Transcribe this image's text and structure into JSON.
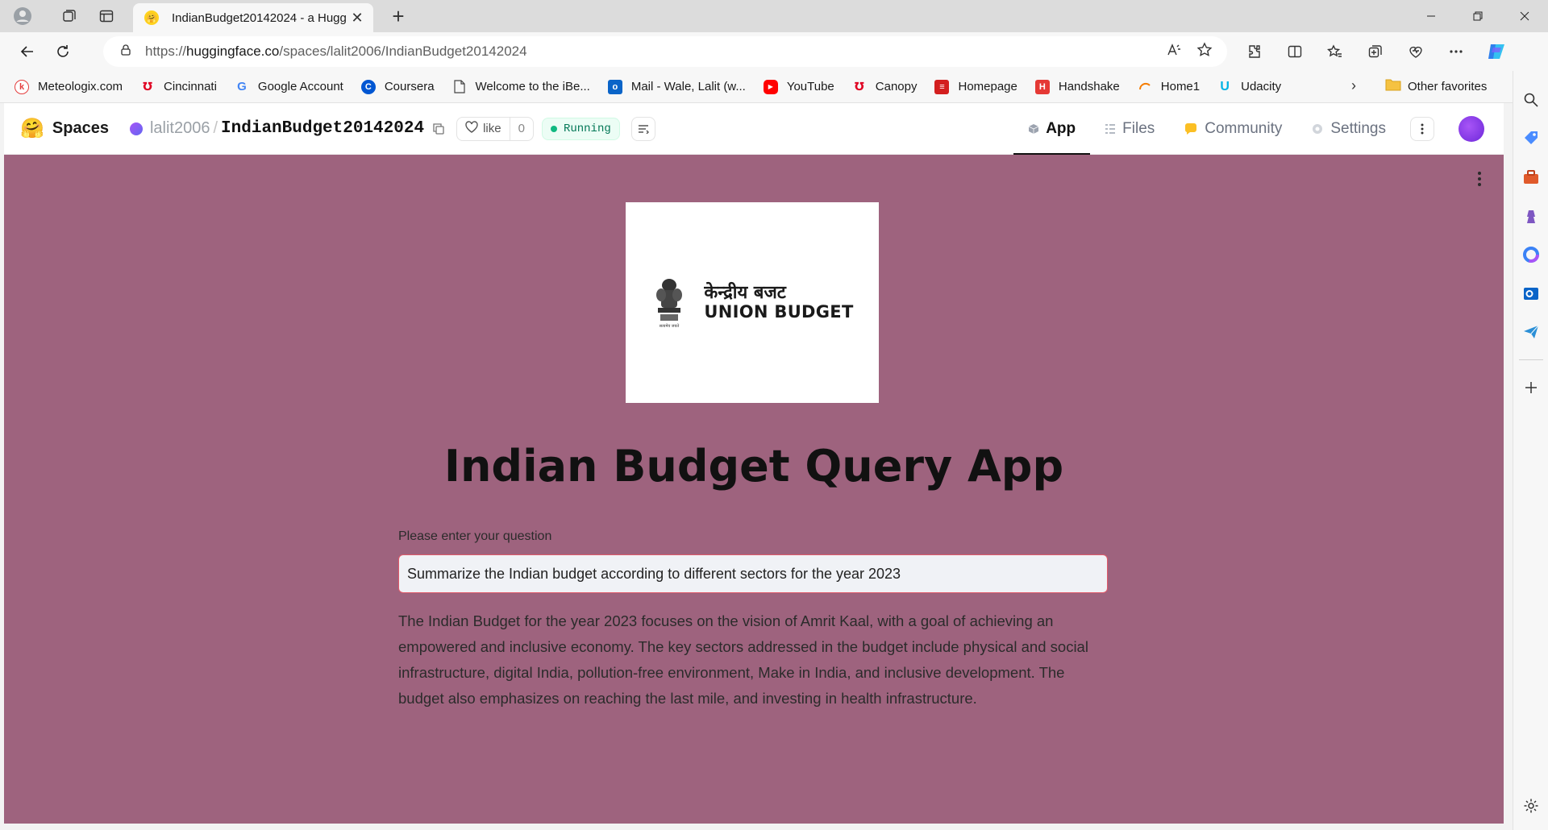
{
  "browser": {
    "tab_title": "IndianBudget20142024 - a Hugg",
    "url_prefix": "https://",
    "url_host": "huggingface.co",
    "url_path": "/spaces/lalit2006/IndianBudget20142024",
    "new_tab_symbol": "+",
    "bookmarks": [
      {
        "label": "Meteologix.com",
        "icon": "meteologix-icon",
        "color": "#e43d3d"
      },
      {
        "label": "Cincinnati",
        "icon": "uc-icon",
        "color": "#e00122"
      },
      {
        "label": "Google Account",
        "icon": "google-icon",
        "color": "#4285f4"
      },
      {
        "label": "Coursera",
        "icon": "coursera-icon",
        "color": "#0056d2"
      },
      {
        "label": "Welcome to the iBe...",
        "icon": "page-icon",
        "color": "#888888"
      },
      {
        "label": "Mail - Wale, Lalit (w...",
        "icon": "outlook-icon",
        "color": "#0a64c8"
      },
      {
        "label": "YouTube",
        "icon": "youtube-icon",
        "color": "#ff0000"
      },
      {
        "label": "Canopy",
        "icon": "uc-icon",
        "color": "#e00122"
      },
      {
        "label": "Homepage",
        "icon": "homepage-icon",
        "color": "#d31f1f"
      },
      {
        "label": "Handshake",
        "icon": "handshake-icon",
        "color": "#e53935"
      },
      {
        "label": "Home1",
        "icon": "home1-icon",
        "color": "#f57c00"
      },
      {
        "label": "Udacity",
        "icon": "udacity-icon",
        "color": "#02b3e4"
      }
    ],
    "other_favorites": "Other favorites"
  },
  "hf": {
    "spaces_label": "Spaces",
    "owner": "lalit2006",
    "repo": "IndianBudget20142024",
    "like_label": "like",
    "like_count": "0",
    "status": "Running",
    "nav": {
      "app": "App",
      "files": "Files",
      "community": "Community",
      "settings": "Settings"
    }
  },
  "app": {
    "logo_hindi": "केन्द्रीय बजट",
    "logo_english": "UNION BUDGET",
    "title": "Indian Budget Query App",
    "question_label": "Please enter your question",
    "question_value": "Summarize the Indian budget according to different sectors for the year 2023",
    "answer": "The Indian Budget for the year 2023 focuses on the vision of Amrit Kaal, with a goal of achieving an empowered and inclusive economy. The key sectors addressed in the budget include physical and social infrastructure, digital India, pollution-free environment, Make in India, and inclusive development. The budget also emphasizes on reaching the last mile, and investing in health infrastructure."
  },
  "colors": {
    "app_background": "#9e637e",
    "status_green": "#10b981",
    "input_border": "#e05a6a"
  }
}
